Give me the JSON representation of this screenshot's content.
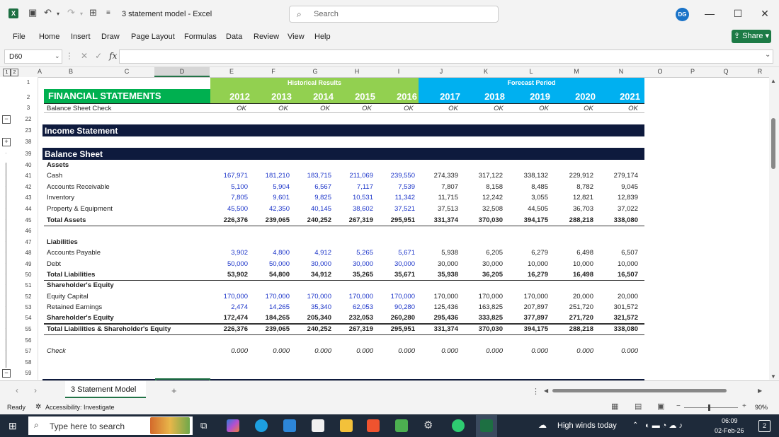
{
  "app": {
    "doc_title": "3 statement model  -  Excel",
    "search_placeholder": "Search",
    "avatar_initials": "DG",
    "logo_letter": "X"
  },
  "menu": [
    "File",
    "Home",
    "Insert",
    "Draw",
    "Page Layout",
    "Formulas",
    "Data",
    "Review",
    "View",
    "Help"
  ],
  "share_label": "Share",
  "formula_bar": {
    "name_box": "D60",
    "value": ""
  },
  "columns": [
    "A",
    "B",
    "C",
    "D",
    "E",
    "F",
    "G",
    "H",
    "I",
    "J",
    "K",
    "L",
    "M",
    "N",
    "O",
    "P",
    "Q",
    "R"
  ],
  "outline_levels": [
    "1",
    "2"
  ],
  "rows": [
    "1",
    "2",
    "3",
    "22",
    "23",
    "38",
    "39",
    "40",
    "41",
    "42",
    "43",
    "44",
    "45",
    "46",
    "47",
    "48",
    "49",
    "50",
    "51",
    "52",
    "53",
    "54",
    "55",
    "56",
    "57",
    "58",
    "59"
  ],
  "sheet": {
    "historical_label": "Historical Results",
    "forecast_label": "Forecast Period",
    "title": "FINANCIAL STATEMENTS",
    "years": [
      "2012",
      "2013",
      "2014",
      "2015",
      "2016",
      "2017",
      "2018",
      "2019",
      "2020",
      "2021"
    ],
    "check_label": "Balance Sheet Check",
    "check_values": [
      "OK",
      "OK",
      "OK",
      "OK",
      "OK",
      "OK",
      "OK",
      "OK",
      "OK",
      "OK"
    ],
    "income_header": "Income Statement",
    "balance_header": "Balance Sheet",
    "lines": [
      {
        "label": "Assets",
        "style": "bold",
        "vals": []
      },
      {
        "label": "Cash",
        "style": "",
        "vals": [
          "167,971",
          "181,210",
          "183,715",
          "211,069",
          "239,550",
          "274,339",
          "317,122",
          "338,132",
          "229,912",
          "279,174"
        ]
      },
      {
        "label": "Accounts Receivable",
        "style": "",
        "vals": [
          "5,100",
          "5,904",
          "6,567",
          "7,117",
          "7,539",
          "7,807",
          "8,158",
          "8,485",
          "8,782",
          "9,045"
        ]
      },
      {
        "label": "Inventory",
        "style": "",
        "vals": [
          "7,805",
          "9,601",
          "9,825",
          "10,531",
          "11,342",
          "11,715",
          "12,242",
          "3,055",
          "12,821",
          "12,839"
        ]
      },
      {
        "label": "Property & Equipment",
        "style": "",
        "vals": [
          "45,500",
          "42,350",
          "40,145",
          "38,602",
          "37,521",
          "37,513",
          "32,508",
          "44,505",
          "36,703",
          "37,022"
        ]
      },
      {
        "label": "Total Assets",
        "style": "bold",
        "vals": [
          "226,376",
          "239,065",
          "240,252",
          "267,319",
          "295,951",
          "331,374",
          "370,030",
          "394,175",
          "288,218",
          "338,080"
        ]
      },
      {
        "label": "",
        "style": "",
        "vals": []
      },
      {
        "label": "Liabilities",
        "style": "bold",
        "vals": []
      },
      {
        "label": "Accounts Payable",
        "style": "",
        "vals": [
          "3,902",
          "4,800",
          "4,912",
          "5,265",
          "5,671",
          "5,938",
          "6,205",
          "6,279",
          "6,498",
          "6,507"
        ]
      },
      {
        "label": "Debt",
        "style": "",
        "vals": [
          "50,000",
          "50,000",
          "30,000",
          "30,000",
          "30,000",
          "30,000",
          "30,000",
          "10,000",
          "10,000",
          "10,000"
        ]
      },
      {
        "label": "Total Liabilities",
        "style": "bold",
        "vals": [
          "53,902",
          "54,800",
          "34,912",
          "35,265",
          "35,671",
          "35,938",
          "36,205",
          "16,279",
          "16,498",
          "16,507"
        ]
      },
      {
        "label": "Shareholder's Equity",
        "style": "bold",
        "vals": []
      },
      {
        "label": "Equity Capital",
        "style": "",
        "vals": [
          "170,000",
          "170,000",
          "170,000",
          "170,000",
          "170,000",
          "170,000",
          "170,000",
          "170,000",
          "20,000",
          "20,000"
        ]
      },
      {
        "label": "Retained Earnings",
        "style": "",
        "vals": [
          "2,474",
          "14,265",
          "35,340",
          "62,053",
          "90,280",
          "125,436",
          "163,825",
          "207,897",
          "251,720",
          "301,572"
        ]
      },
      {
        "label": "Shareholder's Equity",
        "style": "bold",
        "vals": [
          "172,474",
          "184,265",
          "205,340",
          "232,053",
          "260,280",
          "295,436",
          "333,825",
          "377,897",
          "271,720",
          "321,572"
        ]
      },
      {
        "label": "Total Liabilities & Shareholder's Equity",
        "style": "bold",
        "vals": [
          "226,376",
          "239,065",
          "240,252",
          "267,319",
          "295,951",
          "331,374",
          "370,030",
          "394,175",
          "288,218",
          "338,080"
        ]
      },
      {
        "label": "",
        "style": "",
        "vals": []
      },
      {
        "label": "Check",
        "style": "ital",
        "vals": [
          "0.000",
          "0.000",
          "0.000",
          "0.000",
          "0.000",
          "0.000",
          "0.000",
          "0.000",
          "0.000",
          "0.000"
        ]
      }
    ]
  },
  "sheet_tab": "3 Statement Model",
  "status": {
    "ready": "Ready",
    "accessibility": "Accessibility: Investigate",
    "zoom": "90%"
  },
  "taskbar": {
    "search_placeholder": "Type here to search",
    "weather": "High winds today",
    "time": "06:09",
    "date": "02-Feb-26",
    "notifications": "2"
  },
  "colors": {
    "historical_green": "#92d050",
    "forecast_blue": "#00b0f0",
    "title_green": "#00b050",
    "section_navy": "#0e1a3d",
    "input_blue": "#1c35c9",
    "excel_green": "#1d6f42"
  }
}
